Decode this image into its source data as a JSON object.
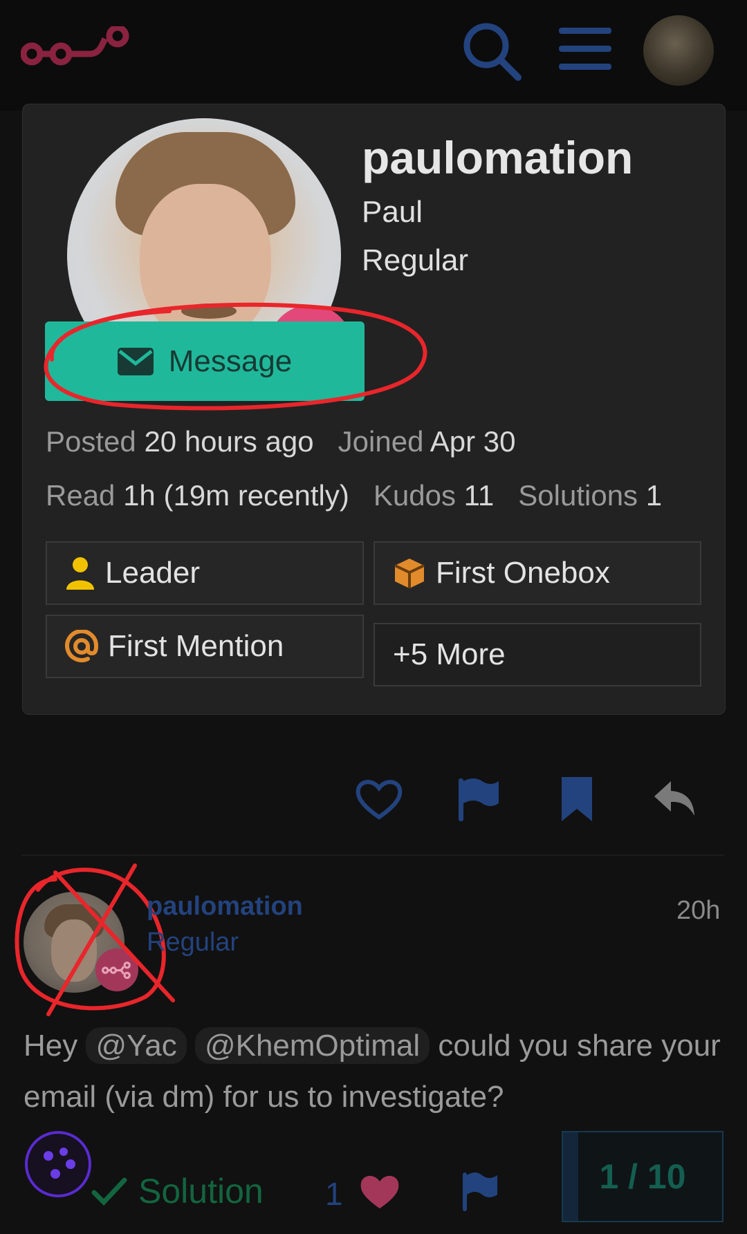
{
  "header": {
    "logo": "n8n-logo",
    "icons": [
      "search-icon",
      "hamburger-menu-icon",
      "user-avatar"
    ]
  },
  "user_card": {
    "username": "paulomation",
    "name": "Paul",
    "title": "Regular",
    "message_button": "Message",
    "posted_label": "Posted",
    "posted_value": "20 hours ago",
    "joined_label": "Joined",
    "joined_value": "Apr 30",
    "read_label": "Read",
    "read_value": "1h (19m recently)",
    "kudos_label": "Kudos",
    "kudos_value": "11",
    "solutions_label": "Solutions",
    "solutions_value": "1",
    "badges": [
      {
        "label": "Leader",
        "icon": "user-icon",
        "color": "#f2c200"
      },
      {
        "label": "First Onebox",
        "icon": "cube-icon",
        "color": "#e18b2c"
      },
      {
        "label": "First Mention",
        "icon": "at-icon",
        "color": "#e18b2c"
      },
      {
        "label": "+5 More",
        "icon": "",
        "color": ""
      }
    ]
  },
  "post_actions": [
    "heart-icon",
    "flag-icon",
    "bookmark-icon",
    "reply-icon"
  ],
  "post": {
    "username": "paulomation",
    "title": "Regular",
    "time": "20h",
    "body_pre": "Hey",
    "mention1": "@Yac",
    "mention2": "@KhemOptimal",
    "body_post": "could you share your email (via dm) for us to investigate?"
  },
  "bottom": {
    "solution_label": "Solution",
    "likes": "1",
    "progress": "1 / 10"
  },
  "colors": {
    "accent_teal": "#20b89a",
    "brand_pink": "#e3487a",
    "link_blue": "#23437e",
    "annotation_red": "#e8262b"
  }
}
